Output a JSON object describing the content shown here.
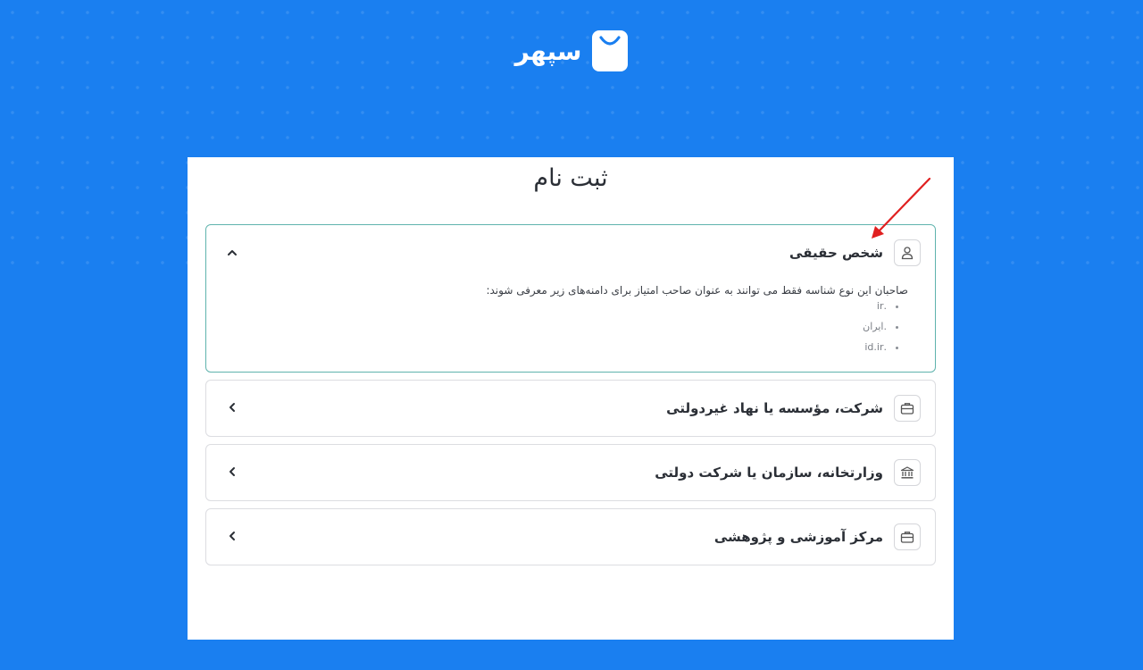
{
  "brand": {
    "name": "سپهر",
    "logo_icon": "shopping-bag-icon"
  },
  "page": {
    "title": "ثبت نام"
  },
  "accordion": {
    "items": [
      {
        "label": "شخص حقیقی",
        "icon": "user-icon",
        "expanded": true,
        "description": "صاحبان این نوع شناسه فقط می توانند به عنوان صاحب امتیاز برای دامنه‌های زیر معرفی شوند:",
        "domains": [
          ".ir",
          ".ایران",
          ".id.ir"
        ]
      },
      {
        "label": "شرکت، مؤسسه یا نهاد غیردولتی",
        "icon": "briefcase-icon",
        "expanded": false
      },
      {
        "label": "وزارتخانه، سازمان یا شرکت دولتی",
        "icon": "bank-icon",
        "expanded": false
      },
      {
        "label": "مرکز آموزشی و پژوهشی",
        "icon": "briefcase-icon",
        "expanded": false
      }
    ]
  },
  "colors": {
    "background": "#1a7ff0",
    "open_border": "#5fb3ad",
    "annotation_arrow": "#e02020"
  }
}
